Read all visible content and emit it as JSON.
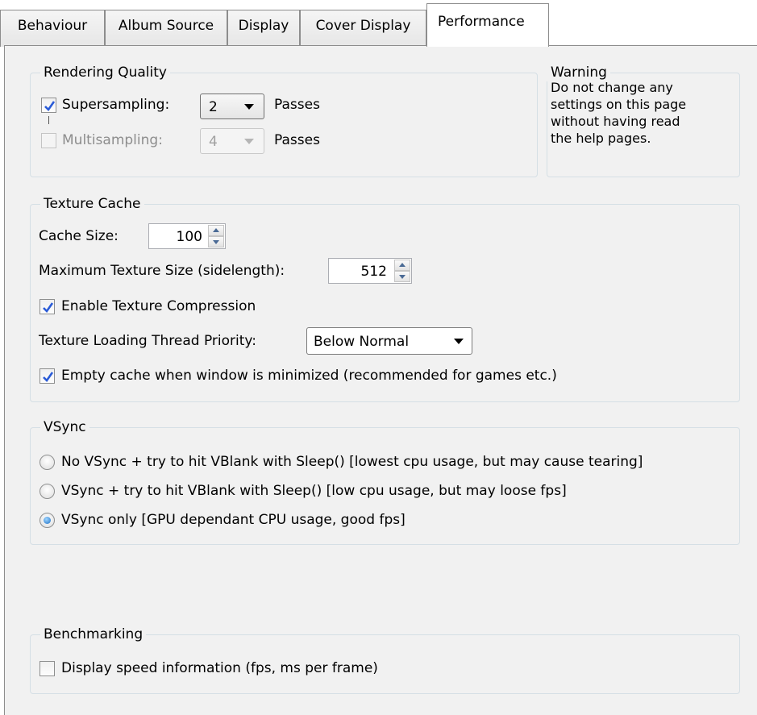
{
  "tabs": [
    {
      "label": "Behaviour"
    },
    {
      "label": "Album Source"
    },
    {
      "label": "Display"
    },
    {
      "label": "Cover Display"
    },
    {
      "label": "Performance"
    }
  ],
  "rendering_quality": {
    "title": "Rendering Quality",
    "supersampling_label": "Supersampling:",
    "supersampling_value": "2",
    "supersampling_unit": "Passes",
    "multisampling_label": "Multisampling:",
    "multisampling_value": "4",
    "multisampling_unit": "Passes"
  },
  "warning": {
    "title": "Warning",
    "text_line1": "Do not change any",
    "text_line2": "settings on this page",
    "text_line3": "without having read",
    "text_line4": "the help pages."
  },
  "texture_cache": {
    "title": "Texture Cache",
    "cache_size_label": "Cache Size:",
    "cache_size_value": "100",
    "max_texture_label": "Maximum Texture Size (sidelength):",
    "max_texture_value": "512",
    "compression_label": "Enable Texture Compression",
    "priority_label": "Texture Loading Thread Priority:",
    "priority_value": "Below Normal",
    "empty_cache_label": "Empty cache when window is minimized (recommended for games etc.)"
  },
  "vsync": {
    "title": "VSync",
    "options": [
      {
        "label": "No VSync + try to hit VBlank with Sleep() [lowest cpu usage, but may cause tearing]",
        "selected": false
      },
      {
        "label": "VSync + try to hit VBlank with Sleep() [low cpu usage, but may loose fps]",
        "selected": false
      },
      {
        "label": "VSync only [GPU dependant CPU usage, good fps]",
        "selected": true
      }
    ]
  },
  "benchmarking": {
    "title": "Benchmarking",
    "speed_label": "Display speed information (fps, ms per frame)"
  },
  "colors": {
    "page_bg": "#f1f1f1",
    "check_blue": "#2a5bd7",
    "radio_blue": "#1e6fc4"
  }
}
